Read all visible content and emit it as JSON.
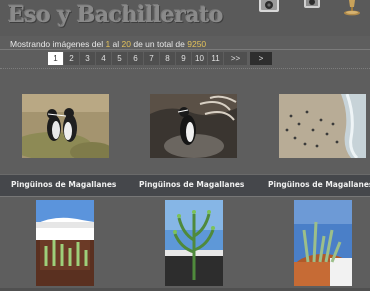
{
  "header": {
    "site_title": "Eso y Bachillerato"
  },
  "status": {
    "prefix": "Mostrando imágenes del ",
    "from": "1",
    "middle1": " al ",
    "to": "20",
    "middle2": " de un total de ",
    "total": "9250"
  },
  "pager": {
    "pages": [
      "1",
      "2",
      "3",
      "4",
      "5",
      "6",
      "7",
      "8",
      "9",
      "10",
      "11"
    ],
    "more_label": ">>",
    "next_label": ">"
  },
  "gallery": {
    "captions": [
      "Pingüinos de Magallanes",
      "Pingüinos de Magallanes",
      "Pingüinos de Magallanes"
    ]
  },
  "colors": {
    "background": "#5e5e5e",
    "accent_number": "#e3c25a",
    "caption_bar": "#45474b"
  },
  "icons": [
    "speaker-icon",
    "speaker-icon",
    "trophy-icon"
  ]
}
